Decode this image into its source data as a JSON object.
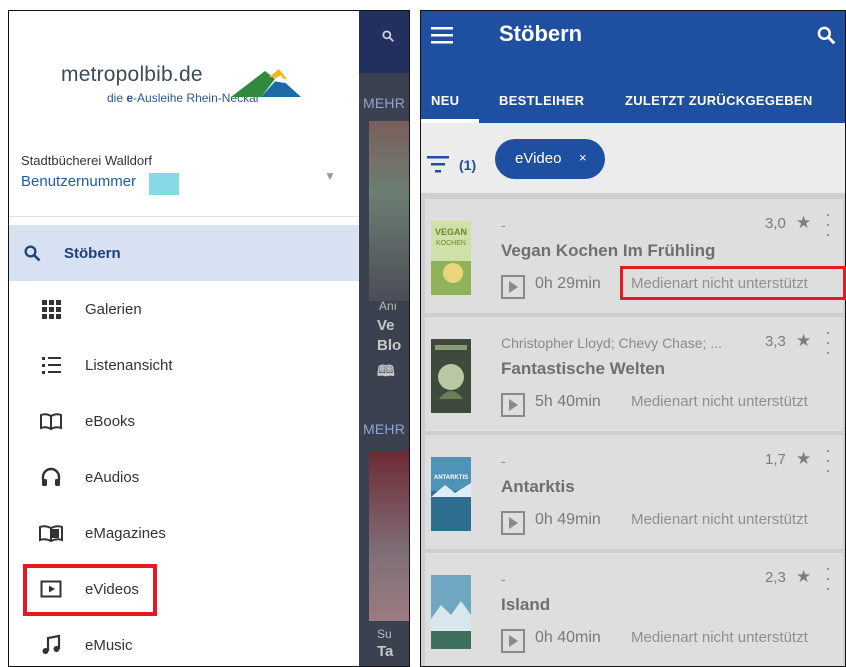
{
  "left_panel": {
    "logo": {
      "main": "metropolbib.de",
      "tagline_prefix": "die ",
      "tagline_bold": "e",
      "tagline_rest": "-Ausleihe Rhein-Neckar"
    },
    "library_name": "Stadtbücherei Walldorf",
    "user_label": "Benutzernummer",
    "active_item": {
      "label": "Stöbern",
      "icon": "search-icon"
    },
    "nav_items": [
      {
        "label": "Galerien",
        "icon": "grid-icon"
      },
      {
        "label": "Listenansicht",
        "icon": "list-icon"
      },
      {
        "label": "eBooks",
        "icon": "book-icon"
      },
      {
        "label": "eAudios",
        "icon": "headphones-icon"
      },
      {
        "label": "eMagazines",
        "icon": "magazine-icon"
      },
      {
        "label": "eVideos",
        "icon": "video-icon"
      },
      {
        "label": "eMusic",
        "icon": "music-icon"
      }
    ],
    "background_app": {
      "more_1": "MEHR",
      "more_2": "MEHR",
      "text_lines": [
        "Anı",
        "Ve",
        "Blo",
        "🕮"
      ],
      "text_bottom": [
        "Su",
        "Ta"
      ]
    },
    "highlight_color": "#e21b23"
  },
  "right_panel": {
    "title": "Stöbern",
    "tabs": [
      "NEU",
      "BESTLEIHER",
      "ZULETZT ZURÜCKGEGEBEN"
    ],
    "filter_count": "(1)",
    "filter_chip": {
      "label": "eVideo",
      "close": "×"
    },
    "items": [
      {
        "author": "-",
        "rating": "3,0",
        "title": "Vegan Kochen Im Frühling",
        "duration": "0h 29min",
        "status": "Medienart nicht unterstützt"
      },
      {
        "author": "Christopher Lloyd; Chevy Chase; ...",
        "rating": "3,3",
        "title": "Fantastische Welten",
        "duration": "5h 40min",
        "status": "Medienart nicht unterstützt"
      },
      {
        "author": "-",
        "rating": "1,7",
        "title": "Antarktis",
        "duration": "0h 49min",
        "status": "Medienart nicht unterstützt"
      },
      {
        "author": "-",
        "rating": "2,3",
        "title": "Island",
        "duration": "0h 40min",
        "status": "Medienart nicht unterstützt"
      }
    ],
    "colors": {
      "primary": "#1f4fa1",
      "highlight": "#e21b23"
    }
  }
}
